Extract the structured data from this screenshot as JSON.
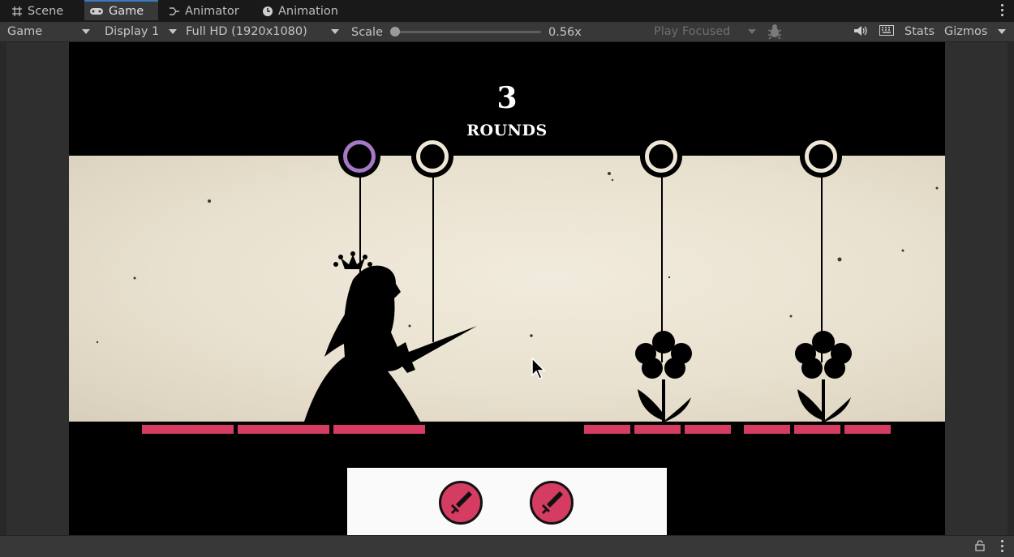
{
  "tabs": [
    {
      "label": "Scene",
      "icon": "grid-icon"
    },
    {
      "label": "Game",
      "icon": "gamepad-icon",
      "active": true
    },
    {
      "label": "Animator",
      "icon": "animator-icon"
    },
    {
      "label": "Animation",
      "icon": "clock-icon"
    }
  ],
  "toolbar": {
    "view_mode": "Game",
    "display": "Display 1",
    "resolution": "Full HD (1920x1080)",
    "scale_label": "Scale",
    "scale_value": "0.56x",
    "play_mode": "Play Focused",
    "stats": "Stats",
    "gizmos": "Gizmos"
  },
  "game": {
    "round_number": "3",
    "round_label": "ROUNDS",
    "colors": {
      "accent": "#d53c62",
      "selected": "#a579c6",
      "ivory": "#efe7d6"
    },
    "player_health_segments": 3,
    "enemy1_health_segments": 3,
    "enemy2_health_segments": 3,
    "action_buttons": [
      "sword-icon",
      "sword-icon"
    ]
  }
}
